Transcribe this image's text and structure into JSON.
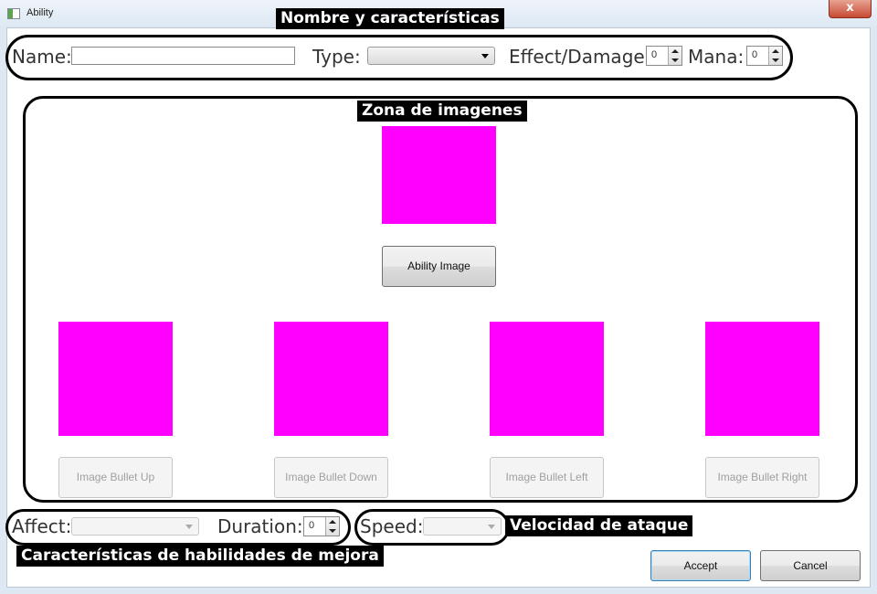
{
  "window": {
    "title": "Ability",
    "close_glyph": "x"
  },
  "annotations": {
    "top": "Nombre y características",
    "images": "Zona de imagenes",
    "upgrade": "Características de habilidades de mejora",
    "speed": "Velocidad de ataque"
  },
  "fields": {
    "name_label": "Name:",
    "name_value": "",
    "type_label": "Type:",
    "type_value": "",
    "effect_label": "Effect/Damage:",
    "effect_value": "0",
    "mana_label": "Mana:",
    "mana_value": "0",
    "affect_label": "Affect:",
    "affect_value": "",
    "duration_label": "Duration:",
    "duration_value": "0",
    "speed_label": "Speed:",
    "speed_value": ""
  },
  "buttons": {
    "ability_image": "Ability Image",
    "bullet_up": "Image Bullet Up",
    "bullet_down": "Image Bullet Down",
    "bullet_left": "Image Bullet Left",
    "bullet_right": "Image Bullet Right",
    "accept": "Accept",
    "cancel": "Cancel"
  },
  "colors": {
    "image_placeholder": "#ff00ff"
  }
}
